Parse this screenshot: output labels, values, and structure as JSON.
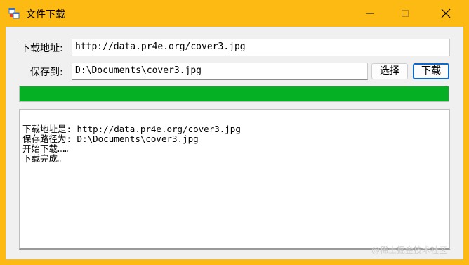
{
  "window": {
    "title": "文件下载",
    "icon": "app-window-icon",
    "title_color": "#fdba12"
  },
  "form": {
    "url_label": "下载地址:",
    "url_value": "http://data.pr4e.org/cover3.jpg",
    "save_label": "保存到:",
    "save_value": "D:\\Documents\\cover3.jpg",
    "browse_button": "选择",
    "download_button": "下载"
  },
  "progress": {
    "value": 1.0,
    "color": "#06b025"
  },
  "log": {
    "lines": [
      "下载地址是: http://data.pr4e.org/cover3.jpg",
      "保存路径为: D:\\Documents\\cover3.jpg",
      "开始下载……",
      "下载完成。"
    ]
  },
  "watermark": "@稀土掘金技术社区"
}
